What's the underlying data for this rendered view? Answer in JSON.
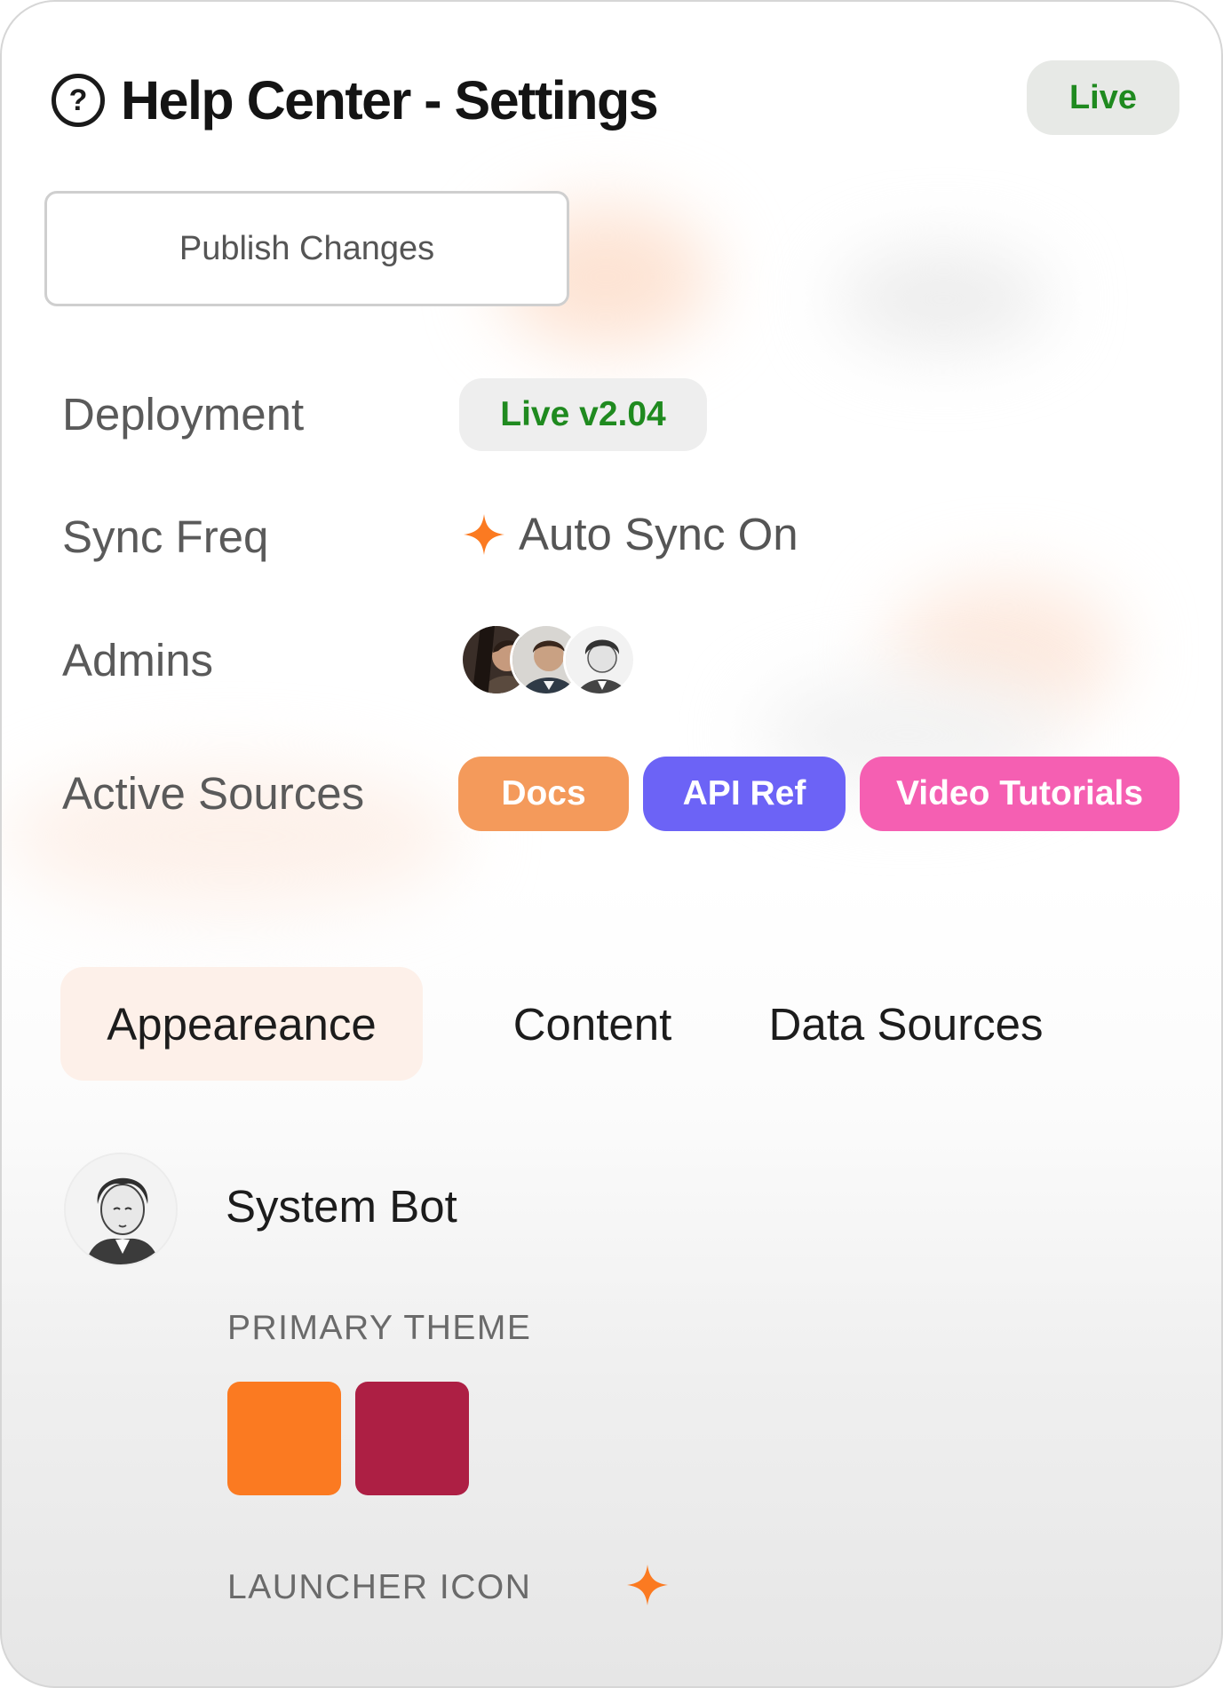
{
  "header": {
    "title": "Help Center - Settings",
    "help_icon_glyph": "?",
    "help_icon": "question-circle-icon",
    "status_badge": "Live"
  },
  "actions": {
    "publish_label": "Publish Changes"
  },
  "rows": {
    "deployment": {
      "label": "Deployment",
      "value": "Live v2.04"
    },
    "sync": {
      "label": "Sync Freq",
      "value": "Auto Sync On",
      "icon": "sparkle-icon"
    },
    "admins": {
      "label": "Admins",
      "avatars": [
        "admin-avatar-1",
        "admin-avatar-2",
        "admin-avatar-3"
      ]
    },
    "sources": {
      "label": "Active Sources",
      "chips": [
        {
          "label": "Docs",
          "color": "#f49a5b"
        },
        {
          "label": "API Ref",
          "color": "#6c63f6"
        },
        {
          "label": "Video Tutorials",
          "color": "#f55fb2"
        }
      ]
    }
  },
  "tabs": [
    {
      "label": "Appeareance",
      "active": true
    },
    {
      "label": "Content",
      "active": false
    },
    {
      "label": "Data Sources",
      "active": false
    }
  ],
  "bot": {
    "name": "System Bot",
    "primary_theme_label": "PRIMARY THEME",
    "theme_colors": [
      "#fb7a21",
      "#ad1f44"
    ],
    "launcher_icon_label": "LAUNCHER ICON",
    "launcher_icon": "sparkle-icon"
  },
  "colors": {
    "accent": "#fb7a21",
    "live_green": "#1f8a1f"
  }
}
